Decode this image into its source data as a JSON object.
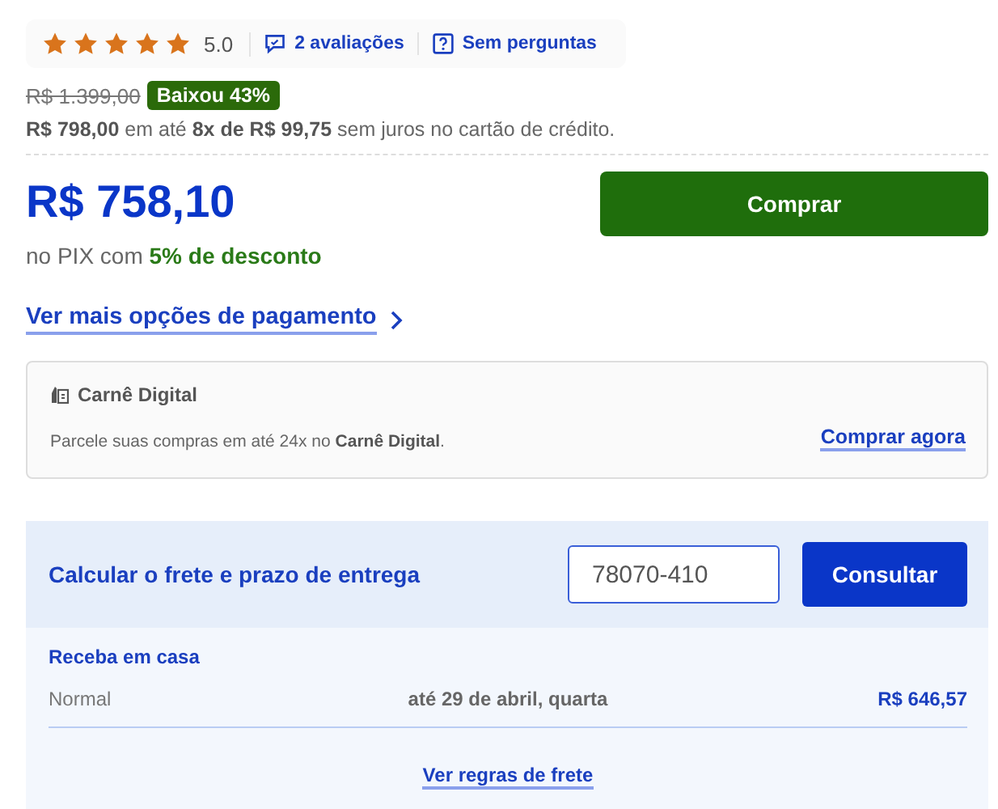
{
  "rating": {
    "stars": 5,
    "score": "5.0",
    "reviews": "2 avaliações",
    "questions": "Sem perguntas"
  },
  "price": {
    "old": "R$ 1.399,00",
    "badge": "Baixou 43%",
    "installments": "**R$ 798,00** em até **8x de R$ 99,75** sem juros no cartão de crédito.",
    "pix_price": "R$ 758,10",
    "pix_note": "no PIX com **5% de desconto**",
    "buy_button": "Comprar",
    "more_payment": "Ver mais opções de pagamento"
  },
  "carne": {
    "title": "Carnê Digital",
    "text": "Parcele suas compras em até 24x no **Carnê Digital**.",
    "link": "Comprar agora"
  },
  "freight": {
    "title": "Calcular o frete e prazo de entrega",
    "cep": "78070-410",
    "button": "Consultar",
    "section": "Receba em casa",
    "options": [
      {
        "name": "Normal",
        "date": "até 29 de abril, quarta",
        "price": "R$ 646,57"
      }
    ],
    "link": "Ver regras de frete"
  }
}
